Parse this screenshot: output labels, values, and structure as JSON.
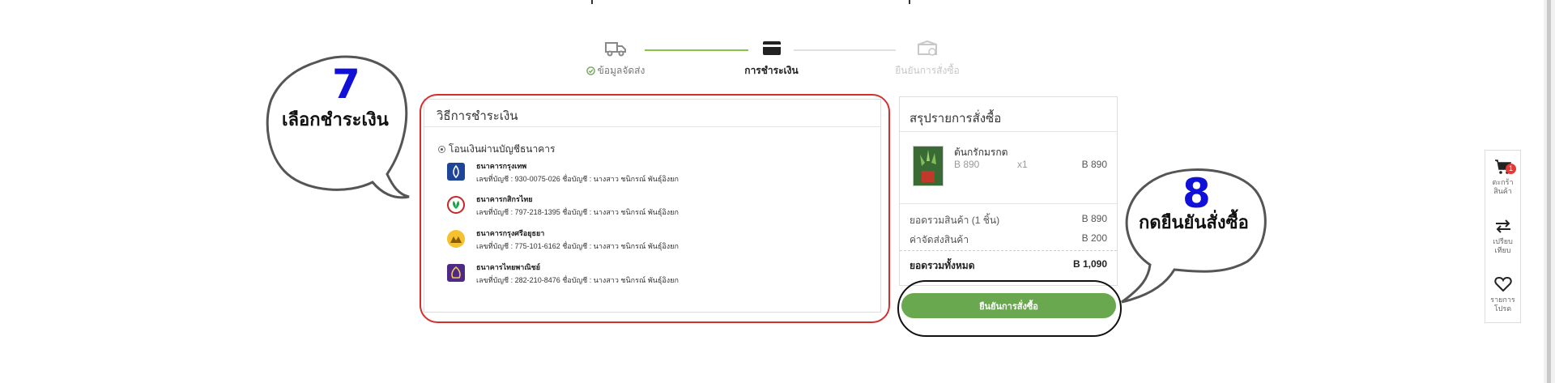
{
  "stepper": {
    "steps": [
      {
        "label": "ข้อมูลจัดส่ง",
        "icon": "truck-icon",
        "state": "done"
      },
      {
        "label": "การชำระเงิน",
        "icon": "credit-card-icon",
        "state": "active"
      },
      {
        "label": "ยืนยันการสั่งซื้อ",
        "icon": "box-check-icon",
        "state": "pending"
      }
    ]
  },
  "payment": {
    "title": "วิธีการชำระเงิน",
    "method_label": "โอนเงินผ่านบัญชีธนาคาร",
    "banks": [
      {
        "name": "ธนาคารกรุงเทพ",
        "account": "เลขที่บัญชี : 930-0075-026 ชื่อบัญชี : นางสาว ชนิกรณ์ พันธุ์อิงยก",
        "color": "#1e4598",
        "icon": "bangkok-bank-logo"
      },
      {
        "name": "ธนาคารกสิกรไทย",
        "account": "เลขที่บัญชี : 797-218-1395 ชื่อบัญชี : นางสาว ชนิกรณ์ พันธุ์อิงยก",
        "color": "#1ba345",
        "icon": "kasikorn-bank-logo"
      },
      {
        "name": "ธนาคารกรุงศรีอยุธยา",
        "account": "เลขที่บัญชี : 775-101-6162 ชื่อบัญชี : นางสาว ชนิกรณ์ พันธุ์อิงยก",
        "color": "#f5c12e",
        "icon": "krungsri-bank-logo"
      },
      {
        "name": "ธนาคารไทยพาณิชย์",
        "account": "เลขที่บัญชี : 282-210-8476 ชื่อบัญชี : นางสาว ชนิกรณ์ พันธุ์อิงยก",
        "color": "#4e2a84",
        "icon": "scb-bank-logo"
      }
    ]
  },
  "summary": {
    "title": "สรุปรายการสั่งซื้อ",
    "product": {
      "name": "ต้นกรักมรกต",
      "price": "B 890",
      "qty": "x1",
      "total": "B 890"
    },
    "subtotal_label": "ยอดรวมสินค้า (1 ชิ้น)",
    "subtotal_value": "B 890",
    "shipping_label": "ค่าจัดส่งสินค้า",
    "shipping_value": "B 200",
    "grand_label": "ยอดรวมทั้งหมด",
    "grand_value": "B 1,090",
    "confirm_label": "ยืนยันการสั่งซื้อ"
  },
  "annotations": {
    "left_number": "7",
    "left_text": "เลือกชำระเงิน",
    "right_number": "8",
    "right_text": "กดยืนยันสั่งซื้อ"
  },
  "toolbar": {
    "cart_label_1": "ตะกร้า",
    "cart_label_2": "สินค้า",
    "cart_badge": "1",
    "compare_label_1": "เปรียบ",
    "compare_label_2": "เทียบ",
    "wishlist_label_1": "รายการ",
    "wishlist_label_2": "โปรด"
  },
  "colors": {
    "accent_green": "#6aa84f",
    "annotation_red": "#d32f2f",
    "annotation_blue": "#1010d8",
    "badge_red": "#e53935"
  }
}
